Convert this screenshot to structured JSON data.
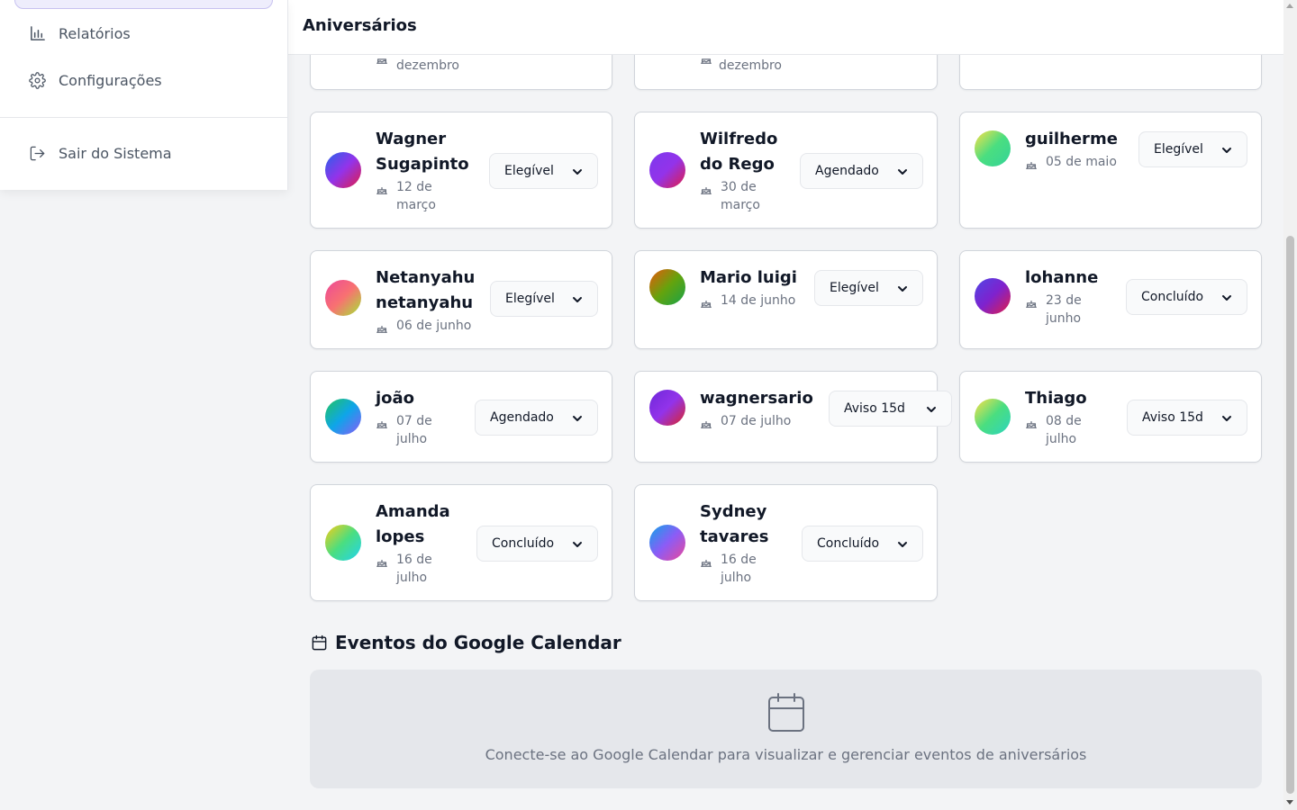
{
  "sidebar": {
    "items": [
      {
        "label": "Relatórios",
        "icon": "bar-chart-icon"
      },
      {
        "label": "Configurações",
        "icon": "gear-icon"
      }
    ],
    "logout": {
      "label": "Sair do Sistema",
      "icon": "logout-icon"
    }
  },
  "header": {
    "title": "Aniversários"
  },
  "partial_cards": [
    {
      "date": "dezembro"
    },
    {
      "date": "dezembro"
    }
  ],
  "cards": [
    {
      "name_lines": [
        "Wagner",
        "Sugapinto"
      ],
      "date_lines": [
        "12 de",
        "março"
      ],
      "status": "Elegível",
      "gradient": [
        "#2563eb",
        "#9333ea",
        "#e11d48"
      ]
    },
    {
      "name_lines": [
        "Wilfredo",
        "do Rego"
      ],
      "date_lines": [
        "30 de",
        "março"
      ],
      "status": "Agendado",
      "gradient": [
        "#7c3aed",
        "#9333ea",
        "#e11d48"
      ]
    },
    {
      "name_lines": [
        "guilherme"
      ],
      "date_lines": [
        "05 de maio"
      ],
      "status": "Elegível",
      "gradient": [
        "#fde047",
        "#4ade80",
        "#34d399"
      ]
    },
    {
      "name_lines": [
        "Netanyahu",
        "netanyahu"
      ],
      "date_lines": [
        "06 de junho"
      ],
      "status": "Elegível",
      "gradient": [
        "#ec4899",
        "#f87171",
        "#a3e635"
      ]
    },
    {
      "name_lines": [
        "Mario luigi"
      ],
      "date_lines": [
        "14 de junho"
      ],
      "status": "Elegível",
      "gradient": [
        "#ea580c",
        "#65a30d",
        "#16a34a"
      ]
    },
    {
      "name_lines": [
        "lohanne"
      ],
      "date_lines": [
        "23 de",
        "junho"
      ],
      "status": "Concluído",
      "gradient": [
        "#4f46e5",
        "#7e22ce",
        "#e11d48"
      ]
    },
    {
      "name_lines": [
        "joão"
      ],
      "date_lines": [
        "07 de",
        "julho"
      ],
      "status": "Agendado",
      "gradient": [
        "#22c55e",
        "#0ea5e9",
        "#8b5cf6"
      ]
    },
    {
      "name_lines": [
        "wagnersario"
      ],
      "date_lines": [
        "07 de julho"
      ],
      "status": "Aviso 15d",
      "gradient": [
        "#6d28d9",
        "#9333ea",
        "#dc2626"
      ]
    },
    {
      "name_lines": [
        "Thiago"
      ],
      "date_lines": [
        "08 de",
        "julho"
      ],
      "status": "Aviso 15d",
      "gradient": [
        "#fde047",
        "#4ade80",
        "#2dd4bf"
      ]
    },
    {
      "name_lines": [
        "Amanda",
        "lopes"
      ],
      "date_lines": [
        "16 de",
        "julho"
      ],
      "status": "Concluído",
      "gradient": [
        "#facc15",
        "#4ade80",
        "#22d3ee"
      ]
    },
    {
      "name_lines": [
        "Sydney",
        "tavares"
      ],
      "date_lines": [
        "16 de",
        "julho"
      ],
      "status": "Concluído",
      "gradient": [
        "#0ea5e9",
        "#8b5cf6",
        "#ec4899"
      ]
    }
  ],
  "google_calendar": {
    "title": "Eventos do Google Calendar",
    "message": "Conecte-se ao Google Calendar para visualizar e gerenciar eventos de aniversários"
  }
}
